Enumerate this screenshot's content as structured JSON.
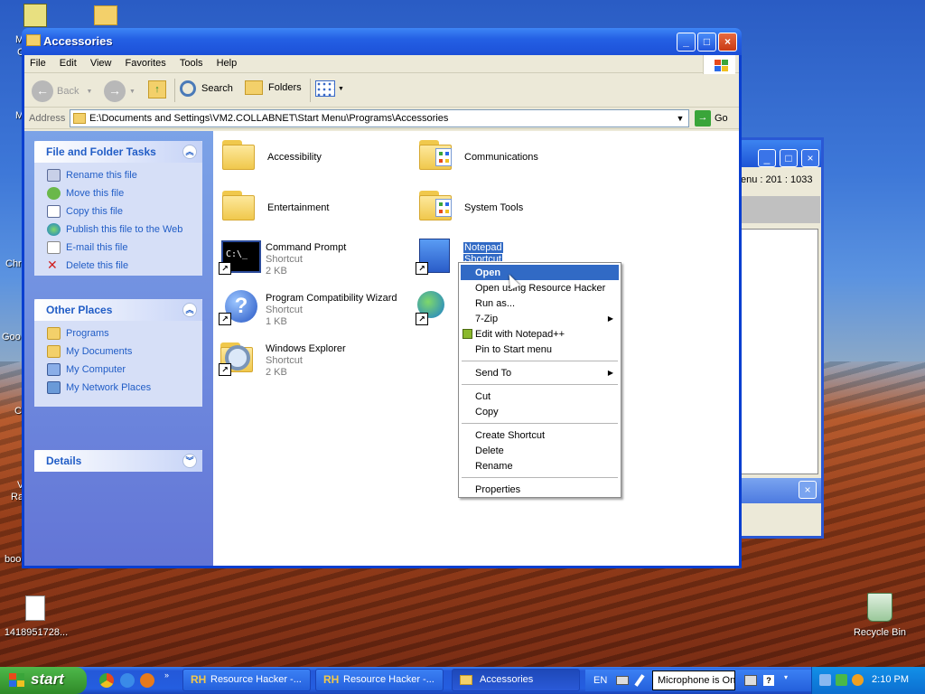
{
  "window": {
    "title": "Accessories",
    "menu": [
      "File",
      "Edit",
      "View",
      "Favorites",
      "Tools",
      "Help"
    ],
    "toolbar": {
      "back": "Back",
      "search": "Search",
      "folders": "Folders"
    },
    "address": {
      "label": "Address",
      "value": "E:\\Documents and Settings\\VM2.COLLABNET\\Start Menu\\Programs\\Accessories",
      "go": "Go"
    }
  },
  "taskpane": {
    "file_tasks": {
      "title": "File and Folder Tasks",
      "items": [
        "Rename this file",
        "Move this file",
        "Copy this file",
        "Publish this file to the Web",
        "E-mail this file",
        "Delete this file"
      ]
    },
    "other_places": {
      "title": "Other Places",
      "items": [
        "Programs",
        "My Documents",
        "My Computer",
        "My Network Places"
      ]
    },
    "details": {
      "title": "Details"
    }
  },
  "files": [
    {
      "name": "Accessibility"
    },
    {
      "name": "Communications"
    },
    {
      "name": "Entertainment"
    },
    {
      "name": "System Tools"
    },
    {
      "name": "Command Prompt",
      "type": "Shortcut",
      "size": "2 KB"
    },
    {
      "name": "Notepad",
      "type": "Shortcut"
    },
    {
      "name": "Program Compatibility Wizard",
      "type": "Shortcut",
      "size": "1 KB"
    },
    {
      "name": "Windows Explorer",
      "type": "Shortcut",
      "size": "2 KB"
    }
  ],
  "context_menu": {
    "items": [
      "Open",
      "Open using Resource Hacker",
      "Run as...",
      "7-Zip",
      "Edit with Notepad++",
      "Pin to Start menu",
      "Send To",
      "Cut",
      "Copy",
      "Create Shortcut",
      "Delete",
      "Rename",
      "Properties"
    ]
  },
  "background_window": {
    "coords": "enu : 201 : 1033"
  },
  "desktop": {
    "icons": {
      "file": "1418951728...",
      "recycle": "Recycle Bin"
    },
    "fragments": [
      "M",
      "C",
      "M",
      "Chr",
      "Goo",
      "C",
      "V",
      "Ra",
      "boo"
    ]
  },
  "taskbar": {
    "start": "start",
    "tasks": [
      "Resource Hacker -...",
      "Resource Hacker -...",
      "Accessories"
    ],
    "lang": "EN",
    "mic": "Microphone is On",
    "clock": "2:10 PM"
  }
}
